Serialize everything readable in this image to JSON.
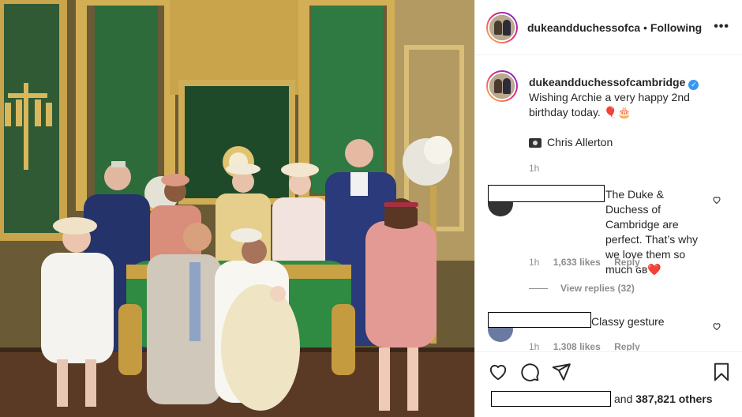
{
  "post": {
    "username": "dukeandduchessofcambridge",
    "username_truncated": "dukeandduchessofcam",
    "separator": "•",
    "follow_status": "Following",
    "more_label": "•••",
    "verified_mark": "✓",
    "caption": {
      "username": "dukeandduchessofcambridge",
      "text": "Wishing Archie a very happy 2nd birthday today. 🎈🎂",
      "credit": "Chris Allerton",
      "time": "1h"
    }
  },
  "comments": [
    {
      "text": "The Duke & Duchess of Cambridge are perfect. That’s why we love them so much ɢʙ❤️",
      "time": "1h",
      "likes": "1,633 likes",
      "reply_label": "Reply",
      "view_replies": "View replies (32)"
    },
    {
      "text": "Classy gesture",
      "time": "1h",
      "likes": "1,308 likes",
      "reply_label": "Reply"
    }
  ],
  "actions": {
    "like_icon": "heart-icon",
    "comment_icon": "comment-icon",
    "share_icon": "paper-plane-icon",
    "save_icon": "bookmark-icon",
    "likes_text": "and",
    "likes_count": "387,821 others"
  },
  "colors": {
    "text": "#262626",
    "muted": "#8e8e8e",
    "verified": "#3897f0",
    "border": "#efefef",
    "heart_red": "#ed4956"
  }
}
